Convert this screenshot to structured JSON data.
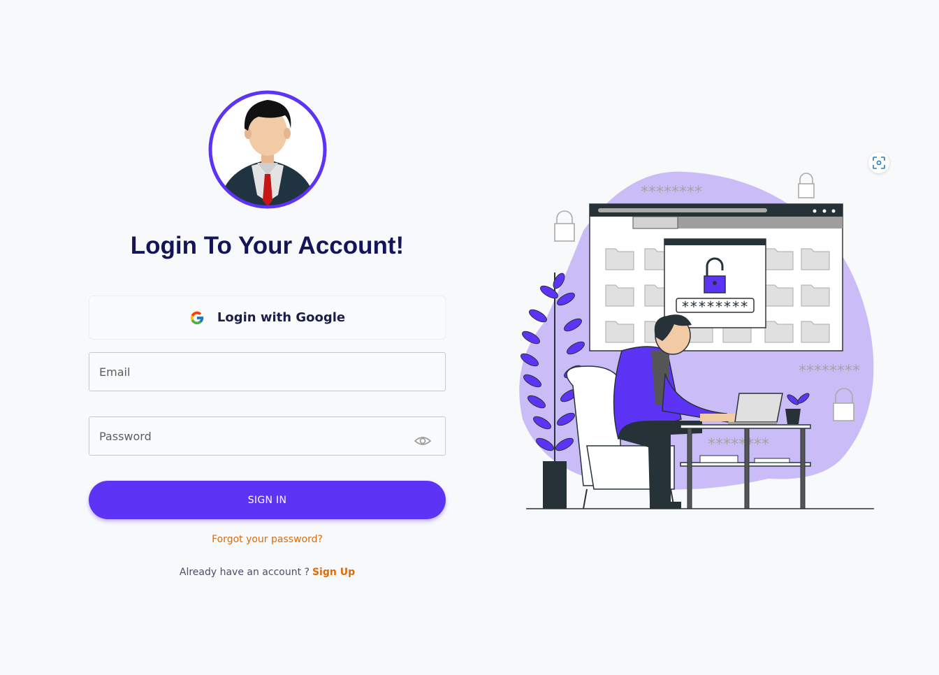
{
  "login": {
    "title": "Login To Your Account!",
    "google_label": "Login with Google",
    "email_placeholder": "Email",
    "password_placeholder": "Password",
    "signin_label": "SIGN IN",
    "forgot_label": "Forgot your password?",
    "account_prompt": "Already have an account ?",
    "signup_label": "Sign Up"
  },
  "illustration": {
    "password_mask": "********",
    "icons": [
      "padlock-icon",
      "folder-icon",
      "plant-icon"
    ]
  },
  "colors": {
    "accent": "#5d34f5",
    "title": "#14145a",
    "link": "#dd6b0a",
    "blob": "#cabdf7",
    "background": "#f8f9fb"
  }
}
